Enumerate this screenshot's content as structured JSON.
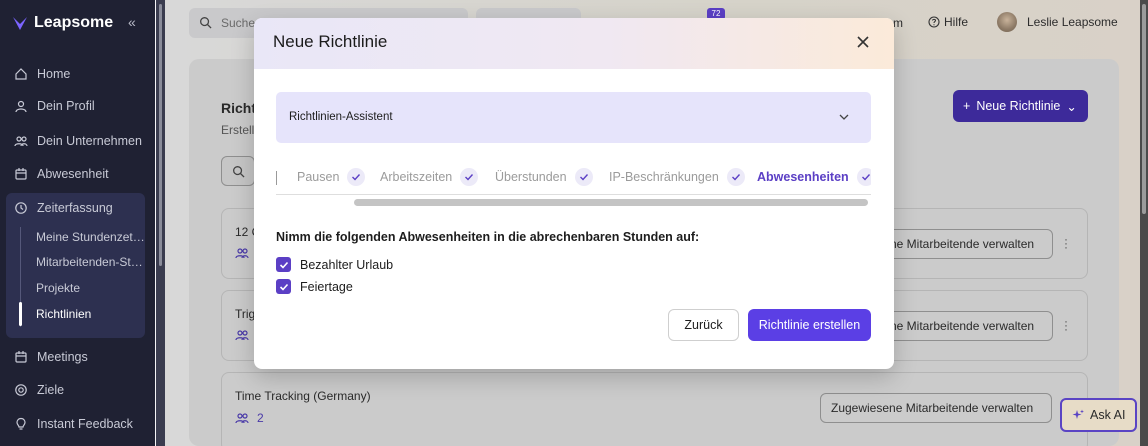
{
  "sidebar": {
    "brand": "Leapsome",
    "collapse_icon": "double-chevron-left-icon",
    "items": [
      {
        "label": "Home",
        "icon": "home-icon"
      },
      {
        "label": "Dein Profil",
        "icon": "user-icon"
      },
      {
        "label": "Dein Unternehmen",
        "icon": "users-icon"
      },
      {
        "label": "Abwesenheit",
        "icon": "calendar-icon"
      },
      {
        "label": "Zeiterfassung",
        "icon": "clock-icon"
      },
      {
        "label": "Meetings",
        "icon": "calendar-icon"
      },
      {
        "label": "Ziele",
        "icon": "target-icon"
      },
      {
        "label": "Instant Feedback",
        "icon": "lightbulb-icon"
      }
    ],
    "sub_items": [
      {
        "label": "Meine Stundenzet…"
      },
      {
        "label": "Mitarbeitenden-St…"
      },
      {
        "label": "Projekte"
      },
      {
        "label": "Richtlinien"
      }
    ]
  },
  "topbar": {
    "search_placeholder": "Suche",
    "notification_count": "72",
    "partial_label": "m",
    "help": "Hilfe",
    "user_name": "Leslie Leapsome"
  },
  "background": {
    "title": "Richt",
    "subtitle": "Erstell",
    "new_policy_button": "Neue Richtlinie",
    "rows": [
      {
        "title": "12 C",
        "count": "",
        "manage": "ne Mitarbeitende verwalten"
      },
      {
        "title": "Trig",
        "count": "",
        "manage": "ne Mitarbeitende verwalten"
      },
      {
        "title": "Time Tracking (Germany)",
        "count": "2",
        "manage": "Zugewiesene Mitarbeitende verwalten"
      }
    ],
    "ask_ai": "Ask AI"
  },
  "modal": {
    "title": "Neue Richtlinie",
    "assistant_label": "Richtlinien-Assistent",
    "steps": [
      {
        "label": "Pausen",
        "active": false
      },
      {
        "label": "Arbeitszeiten",
        "active": false
      },
      {
        "label": "Überstunden",
        "active": false
      },
      {
        "label": "IP-Beschränkungen",
        "active": false
      },
      {
        "label": "Abwesenheiten",
        "active": true
      }
    ],
    "question": "Nimm die folgenden Abwesenheiten in die abrechenbaren Stunden auf:",
    "options": [
      {
        "label": "Bezahlter Urlaub",
        "checked": true
      },
      {
        "label": "Feiertage",
        "checked": true
      }
    ],
    "back_button": "Zurück",
    "create_button": "Richtlinie erstellen"
  },
  "colors": {
    "accent": "#5b3fe5",
    "sidebar_bg": "#1f2133",
    "assistant_bg": "#e6e4fb"
  }
}
